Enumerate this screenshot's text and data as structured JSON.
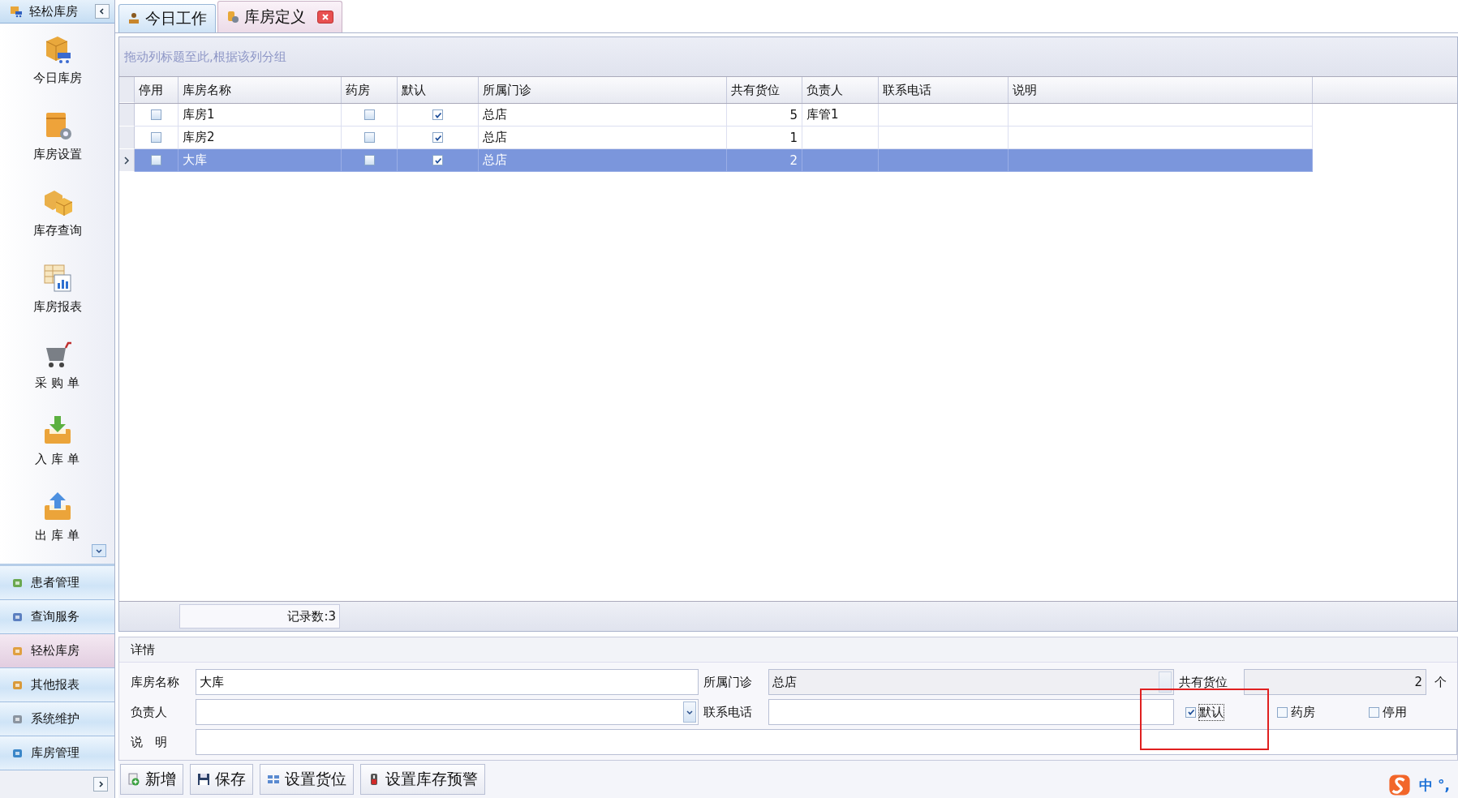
{
  "sidebar": {
    "title": "轻松库房",
    "items": [
      {
        "label": "今日库房"
      },
      {
        "label": "库房设置"
      },
      {
        "label": "库存查询"
      },
      {
        "label": "库房报表"
      },
      {
        "label": "采 购 单"
      },
      {
        "label": "入 库 单"
      },
      {
        "label": "出 库 单"
      }
    ],
    "nav": [
      {
        "label": "患者管理",
        "selected": false
      },
      {
        "label": "查询服务",
        "selected": false
      },
      {
        "label": "轻松库房",
        "selected": true
      },
      {
        "label": "其他报表",
        "selected": false
      },
      {
        "label": "系统维护",
        "selected": false
      },
      {
        "label": "库房管理",
        "selected": false
      }
    ]
  },
  "tabs": [
    {
      "label": "今日工作",
      "selected": false,
      "closable": false
    },
    {
      "label": "库房定义",
      "selected": true,
      "closable": true
    }
  ],
  "grid": {
    "group_hint": "拖动列标题至此,根据该列分组",
    "columns": [
      "停用",
      "库房名称",
      "药房",
      "默认",
      "所属门诊",
      "共有货位",
      "负责人",
      "联系电话",
      "说明"
    ],
    "rows": [
      {
        "disabled": false,
        "name": "库房1",
        "pharmacy": false,
        "default": true,
        "clinic": "总店",
        "slots": "5",
        "manager": "库管1",
        "selected": false
      },
      {
        "disabled": false,
        "name": "库房2",
        "pharmacy": false,
        "default": true,
        "clinic": "总店",
        "slots": "1",
        "selected": false
      },
      {
        "disabled": false,
        "name": "大库",
        "pharmacy": false,
        "default": true,
        "clinic": "总店",
        "slots": "2",
        "selected": true
      }
    ],
    "footer": "记录数:3"
  },
  "details": {
    "title": "详情",
    "name": {
      "label": "库房名称",
      "value": "大库"
    },
    "clinic": {
      "label": "所属门诊",
      "value": "总店"
    },
    "slots": {
      "label": "共有货位",
      "value": "2",
      "unit": "个"
    },
    "manager": {
      "label": "负责人"
    },
    "phone": {
      "label": "联系电话"
    },
    "note": {
      "label": "说　明"
    },
    "checks": [
      {
        "label": "默认",
        "checked": true
      },
      {
        "label": "药房",
        "checked": false
      },
      {
        "label": "停用",
        "checked": false
      }
    ],
    "highlight_box": true
  },
  "buttons": [
    "新增",
    "保存",
    "设置货位",
    "设置库存预警"
  ],
  "ime": {
    "mode": "中",
    "punct": "°,"
  }
}
